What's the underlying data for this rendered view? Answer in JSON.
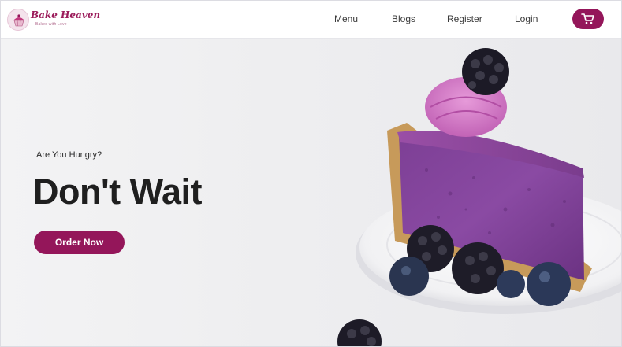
{
  "brand": {
    "name": "Bake Heaven",
    "tagline": "Baked with Love",
    "color": "#94165a"
  },
  "nav": {
    "items": [
      {
        "label": "Menu"
      },
      {
        "label": "Blogs"
      },
      {
        "label": "Register"
      },
      {
        "label": "Login"
      }
    ],
    "cart_icon": "shopping-cart-icon"
  },
  "hero": {
    "subtitle": "Are You Hungry?",
    "title": "Don't Wait",
    "cta_label": "Order Now",
    "image": "blackberry-cheesecake-slice"
  }
}
